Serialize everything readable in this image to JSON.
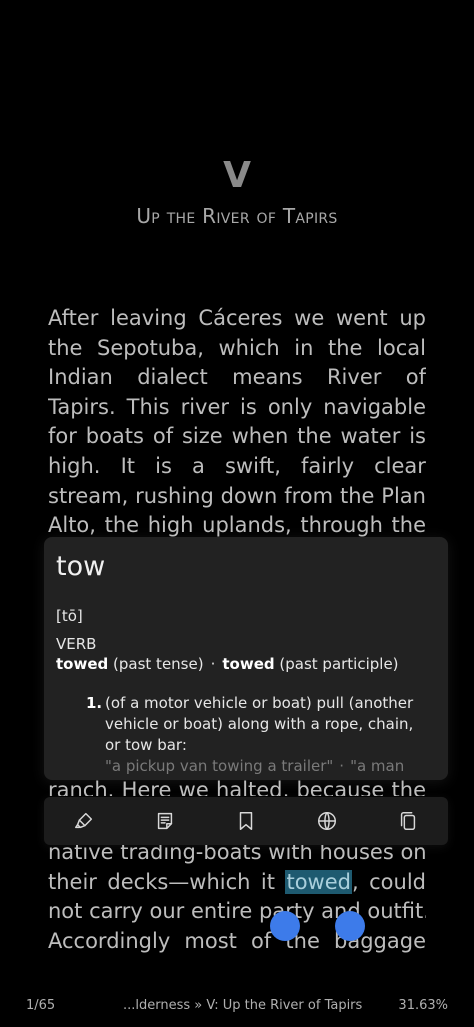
{
  "chapter": {
    "number": "V",
    "title": "Up the River of Tapirs"
  },
  "text_top": [
    "After leaving Cáceres we went up",
    "the Sepotuba, which in the local",
    [
      "Indian",
      "dialect",
      "means",
      "River",
      "of"
    ],
    "Tapirs. This river is only navigable",
    "for boats of size when the water is",
    [
      "high.",
      "It",
      "is",
      "a",
      "swift,",
      "fairly",
      "clear"
    ],
    "stream, rushing down from the Plan",
    "Alto, the high uplands, through the"
  ],
  "text_partial": "ranch. Here we halted, because the",
  "text_bottom": {
    "line1": "native trading-boats with houses on",
    "line2_before": "their decks—which it ",
    "line2_selected": "towed",
    "line2_after": ", could",
    "line3": "not carry our entire party and outfit.",
    "line4": "Accordingly most of the baggage"
  },
  "dictionary": {
    "word": "tow",
    "pronunciation": "[tō]",
    "part_of_speech": "VERB",
    "forms": [
      {
        "form": "towed",
        "label": "(past tense)"
      },
      {
        "form": "towed",
        "label": "(past participle)"
      }
    ],
    "definition_number": "1.",
    "definition": "(of a motor vehicle or boat) pull (another vehicle or boat) along with a rope, chain, or tow bar:",
    "example_1": "\"a pickup van towing a trailer\"",
    "example_separator": "·",
    "example_2": "\"a man"
  },
  "toolbar": {
    "items": [
      {
        "icon": "highlighter-icon"
      },
      {
        "icon": "note-icon"
      },
      {
        "icon": "bookmark-icon"
      },
      {
        "icon": "globe-icon"
      },
      {
        "icon": "copy-icon"
      }
    ]
  },
  "status": {
    "page": "1/65",
    "location": "...lderness » V: Up the River of Tapirs",
    "progress": "31.63%"
  },
  "colors": {
    "background": "#000000",
    "selection": "#1e5a70",
    "handle": "#3d7bea",
    "popup": "#222222"
  }
}
